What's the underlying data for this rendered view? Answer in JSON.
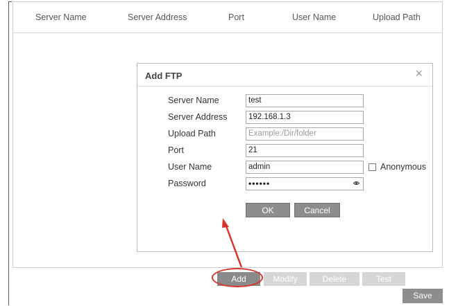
{
  "table": {
    "columns": [
      "Server Name",
      "Server Address",
      "Port",
      "User Name",
      "Upload Path"
    ]
  },
  "dialog": {
    "title": "Add FTP",
    "close_glyph": "×",
    "fields": {
      "server_name": {
        "label": "Server Name",
        "value": "test"
      },
      "server_address": {
        "label": "Server Address",
        "value": "192.168.1.3"
      },
      "upload_path": {
        "label": "Upload Path",
        "placeholder": "Example:/Dir/folder"
      },
      "port": {
        "label": "Port",
        "value": "21"
      },
      "user_name": {
        "label": "User Name",
        "value": "admin"
      },
      "password": {
        "label": "Password",
        "value": "••••••"
      }
    },
    "anonymous_label": "Anonymous",
    "anonymous_checked": false,
    "ok_label": "OK",
    "cancel_label": "Cancel"
  },
  "toolbar": {
    "add_label": "Add",
    "modify_label": "Modify",
    "delete_label": "Delete",
    "test_label": "Test",
    "save_label": "Save"
  },
  "annotation": {
    "highlight_color": "#d9342b",
    "icons": [
      "close-icon",
      "password-reveal-icon"
    ]
  }
}
